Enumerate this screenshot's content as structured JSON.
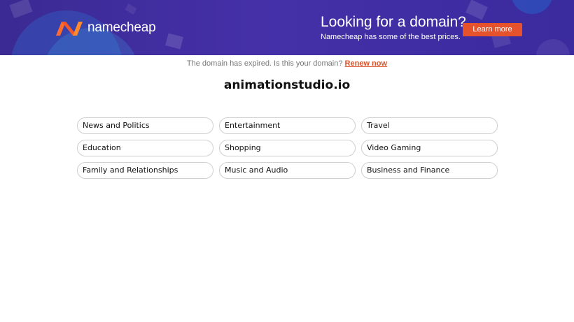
{
  "banner": {
    "logo_text": "namecheap",
    "logo_icon": "namecheap-n-logo-icon",
    "promo_title": "Looking for a domain?",
    "promo_subtitle": "Namecheap has some of the best prices.",
    "cta_label": "Learn more",
    "colors": {
      "background": "#3f2ea3",
      "cta": "#e6522c",
      "logo_accent": "#ff6b2c"
    }
  },
  "notice": {
    "text": "The domain has expired. Is this your domain?",
    "link_label": "Renew now"
  },
  "domain": {
    "name": "animationstudio.io"
  },
  "categories": [
    "News and Politics",
    "Entertainment",
    "Travel",
    "Education",
    "Shopping",
    "Video Gaming",
    "Family and Relationships",
    "Music and Audio",
    "Business and Finance"
  ]
}
